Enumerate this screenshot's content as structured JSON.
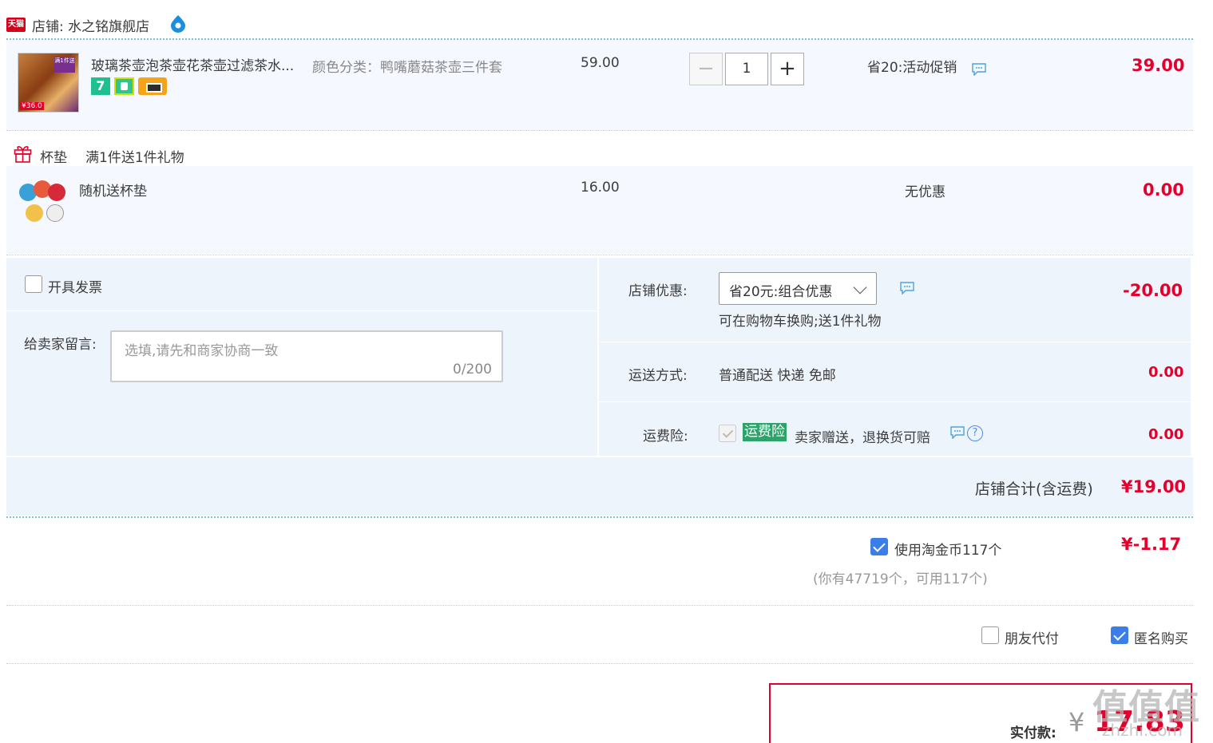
{
  "shop": {
    "badge": "天猫",
    "title": "店铺: 水之铭旗舰店"
  },
  "item1": {
    "title": "玻璃茶壶泡茶壶花茶壶过滤茶水...",
    "sku": "颜色分类：鸭嘴蘑菇茶壶三件套",
    "thumb_tag": "¥36.0",
    "thumb_tag2": "满1件送",
    "service7": "7",
    "price": "59.00",
    "quantity": "1",
    "minus": "−",
    "plus": "+",
    "promo": "省20:活动促销",
    "subtotal": "39.00"
  },
  "gift": {
    "label": "杯垫",
    "rule": "满1件送1件礼物"
  },
  "item2": {
    "title": "随机送杯垫",
    "price": "16.00",
    "promo": "无优惠",
    "subtotal": "0.00"
  },
  "invoice": {
    "label": "开具发票",
    "checked": false
  },
  "message": {
    "label": "给卖家留言:",
    "placeholder": "选填,请先和商家协商一致",
    "counter": "0/200"
  },
  "shop_discount": {
    "label": "店铺优惠:",
    "selected": "省20元:组合优惠",
    "note": "可在购物车换购;送1件礼物",
    "amount": "-20.00"
  },
  "shipping": {
    "label": "运送方式:",
    "value": "普通配送 快递 免邮",
    "amount": "0.00"
  },
  "insurance": {
    "label": "运费险:",
    "badge": "运费险",
    "desc": "卖家赠送，退换货可赔",
    "help": "?",
    "amount": "0.00"
  },
  "shop_total": {
    "label": "店铺合计(含运费)",
    "amount": "¥19.00"
  },
  "coins": {
    "label": "使用淘金币117个",
    "note": "(你有47719个，可用117个)",
    "amount": "¥-1.17",
    "checked": true
  },
  "options": {
    "friend_pay": "朋友代付",
    "anonymous": "匿名购买",
    "anonymous_checked": true
  },
  "payment": {
    "label": "实付款:",
    "currency": "¥",
    "amount": "17.83"
  },
  "watermark": {
    "text": "值值值",
    "sub": "zhzhi.com"
  },
  "colors": {
    "accent_red": "#e4002b",
    "accent_blue": "#3b7ee8",
    "panel_bg": "#eef4fc",
    "insurance_green": "#2ba36a"
  }
}
